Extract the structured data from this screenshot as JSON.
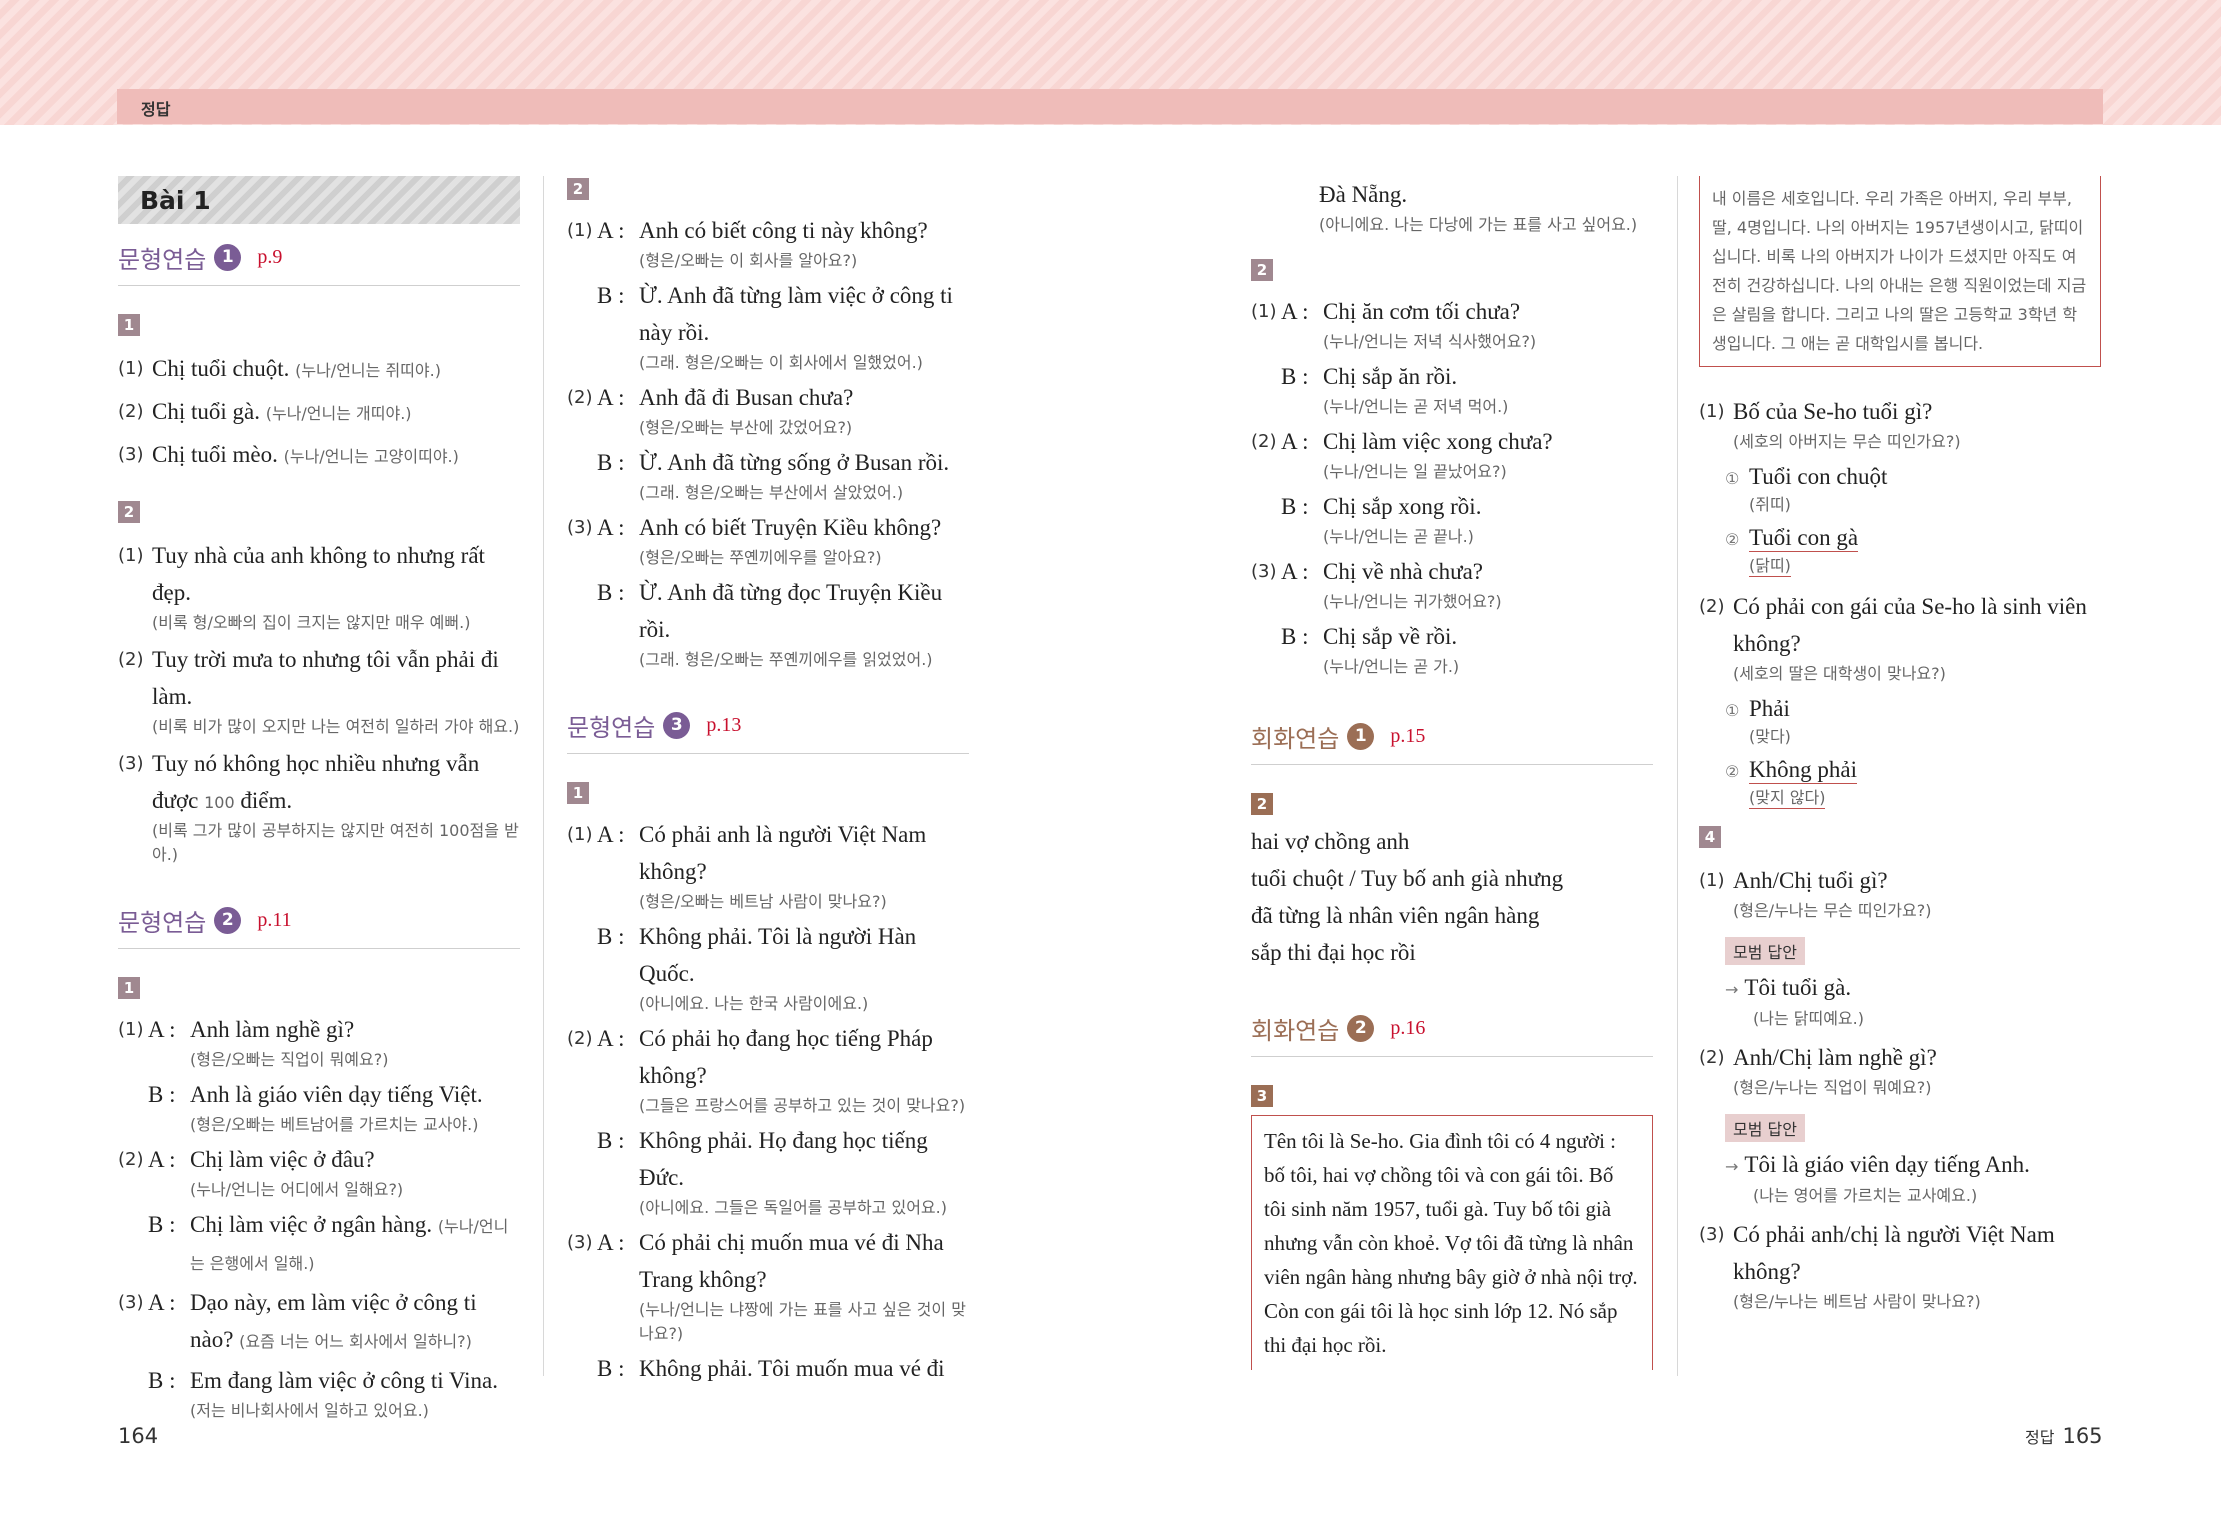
{
  "header": {
    "label": "정답"
  },
  "col1": {
    "bai": "Bài 1",
    "sec1": {
      "title": "문형연습",
      "num": "1",
      "page": "p.9"
    },
    "ex1": {
      "box": "1",
      "items": [
        {
          "num": "(1)",
          "vi": "Chị tuổi chuột.",
          "ko": "(누나/언니는 쥐띠야.)"
        },
        {
          "num": "(2)",
          "vi": "Chị tuổi gà.",
          "ko": "(누나/언니는 개띠야.)"
        },
        {
          "num": "(3)",
          "vi": "Chị tuổi mèo.",
          "ko": "(누나/언니는 고양이띠야.)"
        }
      ]
    },
    "ex2": {
      "box": "2",
      "items": [
        {
          "num": "(1)",
          "vi": "Tuy nhà của anh không to nhưng rất đẹp.",
          "ko": "(비록 형/오빠의 집이 크지는 않지만 매우 예뻐.)"
        },
        {
          "num": "(2)",
          "vi": "Tuy trời mưa to nhưng tôi vẫn phải đi làm.",
          "ko": "(비록 비가 많이 오지만 나는 여전히 일하러 가야 해요.)"
        },
        {
          "num": "(3)",
          "vi_a": "Tuy nó không học nhiều nhưng vẫn được ",
          "vi_num": "100",
          "vi_b": " điểm.",
          "ko": "(비록 그가 많이 공부하지는 않지만 여전히 100점을 받아.)"
        }
      ]
    },
    "sec2": {
      "title": "문형연습",
      "num": "2",
      "page": "p.11"
    },
    "ex3": {
      "box": "1",
      "items": [
        {
          "num": "(1)",
          "a_label": "A :",
          "a_vi": "Anh làm nghề gì?",
          "a_ko": "(형은/오빠는 직업이 뭐예요?)",
          "b_label": "B :",
          "b_vi": "Anh là giáo viên dạy tiếng Việt.",
          "b_ko": "(형은/오빠는 베트남어를 가르치는 교사야.)"
        },
        {
          "num": "(2)",
          "a_label": "A :",
          "a_vi": "Chị làm việc ở đâu?",
          "a_ko": "(누나/언니는 어디에서 일해요?)",
          "b_label": "B :",
          "b_vi": "Chị làm việc ở ngân hàng.",
          "b_ko": "(누나/언니는 은행에서 일해.)"
        },
        {
          "num": "(3)",
          "a_label": "A :",
          "a_vi": "Dạo này, em làm việc ở công ti nào?",
          "a_ko": "(요즘 너는 어느 회사에서 일하니?)",
          "b_label": "B :",
          "b_vi": "Em đang làm việc ở công ti Vina.",
          "b_ko": "(저는 비나회사에서 일하고 있어요.)"
        }
      ]
    }
  },
  "col2": {
    "ex1": {
      "box": "2",
      "items": [
        {
          "num": "(1)",
          "a_label": "A :",
          "a_vi": "Anh có biết công ti này không?",
          "a_ko": "(형은/오빠는 이 회사를 알아요?)",
          "b_label": "B :",
          "b_vi": "Ừ. Anh đã từng làm việc ở công ti này rồi.",
          "b_ko": "(그래. 형은/오빠는 이 회사에서 일했었어.)"
        },
        {
          "num": "(2)",
          "a_label": "A :",
          "a_vi": "Anh đã đi Busan chưa?",
          "a_ko": "(형은/오빠는 부산에 갔었어요?)",
          "b_label": "B :",
          "b_vi": "Ừ. Anh đã từng sống ở Busan rồi.",
          "b_ko": "(그래. 형은/오빠는 부산에서 살았었어.)"
        },
        {
          "num": "(3)",
          "a_label": "A :",
          "a_vi": "Anh có biết Truyện Kiều không?",
          "a_ko": "(형은/오빠는 쭈옌끼에우를 알아요?)",
          "b_label": "B :",
          "b_vi": "Ừ. Anh đã từng đọc Truyện Kiều rồi.",
          "b_ko": "(그래. 형은/오빠는 쭈옌끼에우를 읽었었어.)"
        }
      ]
    },
    "sec3": {
      "title": "문형연습",
      "num": "3",
      "page": "p.13"
    },
    "ex2": {
      "box": "1",
      "items": [
        {
          "num": "(1)",
          "a_label": "A :",
          "a_vi": "Có phải anh là người Việt Nam không?",
          "a_ko": "(형은/오빠는 베트남 사람이 맞나요?)",
          "b_label": "B :",
          "b_vi": "Không phải. Tôi là người Hàn Quốc.",
          "b_ko": "(아니에요. 나는 한국 사람이에요.)"
        },
        {
          "num": "(2)",
          "a_label": "A :",
          "a_vi": "Có phải họ đang học tiếng Pháp không?",
          "a_ko": "(그들은 프랑스어를 공부하고 있는 것이 맞나요?)",
          "b_label": "B :",
          "b_vi": "Không phải. Họ đang học tiếng Đức.",
          "b_ko": "(아니에요. 그들은 독일어를 공부하고 있어요.)"
        },
        {
          "num": "(3)",
          "a_label": "A :",
          "a_vi": "Có phải chị muốn mua vé đi Nha Trang không?",
          "a_ko": "(누나/언니는 냐짱에 가는 표를 사고 싶은 것이 맞나요?)",
          "b_label": "B :",
          "b_vi": "Không phải. Tôi muốn mua vé đi"
        }
      ]
    }
  },
  "col3": {
    "cont_vi": "Đà Nẵng.",
    "cont_ko": "(아니에요. 나는 다낭에 가는 표를 사고 싶어요.)",
    "ex1": {
      "box": "2",
      "items": [
        {
          "num": "(1)",
          "a_label": "A :",
          "a_vi": "Chị ăn cơm tối chưa?",
          "a_ko": "(누나/언니는 저녁 식사했어요?)",
          "b_label": "B :",
          "b_vi": "Chị sắp ăn rồi.",
          "b_ko": "(누나/언니는 곧 저녁 먹어.)"
        },
        {
          "num": "(2)",
          "a_label": "A :",
          "a_vi": "Chị làm việc xong chưa?",
          "a_ko": "(누나/언니는 일 끝났어요?)",
          "b_label": "B :",
          "b_vi": "Chị sắp xong rồi.",
          "b_ko": "(누나/언니는 곧 끝나.)"
        },
        {
          "num": "(3)",
          "a_label": "A :",
          "a_vi": "Chị về nhà chưa?",
          "a_ko": "(누나/언니는 귀가했어요?)",
          "b_label": "B :",
          "b_vi": "Chị sắp về rồi.",
          "b_ko": "(누나/언니는 곧 가.)"
        }
      ]
    },
    "sec4": {
      "title": "회화연습",
      "num": "1",
      "page": "p.15"
    },
    "ex2": {
      "box": "2",
      "lines": [
        "hai vợ chồng anh",
        "tuổi chuột / Tuy bố anh già nhưng",
        "đã từng là nhân viên ngân hàng",
        "sắp thi đại học rồi"
      ]
    },
    "sec5": {
      "title": "회화연습",
      "num": "2",
      "page": "p.16"
    },
    "ex3": {
      "box": "3",
      "text": "Tên tôi là Se-ho. Gia đình tôi có 4 người : bố tôi, hai vợ chồng tôi và con gái tôi. Bố tôi sinh năm 1957, tuổi gà. Tuy bố tôi già nhưng vẫn còn khoẻ. Vợ tôi đã từng là nhân viên ngân hàng nhưng bây giờ ở nhà nội trợ. Còn con gái tôi là học sinh lớp 12. Nó sắp thi đại học rồi."
    }
  },
  "col4": {
    "kor_box": "내 이름은 세호입니다. 우리 가족은 아버지, 우리 부부, 딸, 4명입니다. 나의 아버지는 1957년생이시고, 닭띠이십니다. 비록 나의 아버지가 나이가 드셨지만 아직도 여전히 건강하십니다. 나의 아내는 은행 직원이었는데 지금은 살림을 합니다. 그리고 나의 딸은 고등학교 3학년 학생입니다. 그 애는 곧 대학입시를 봅니다.",
    "q1": {
      "num": "(1)",
      "vi": "Bố của Se-ho tuổi gì?",
      "ko": "(세호의 아버지는 무슨 띠인가요?)",
      "opts": [
        {
          "c": "①",
          "vi": "Tuổi con chuột",
          "ko": "(쥐띠)",
          "u": false
        },
        {
          "c": "②",
          "vi": "Tuổi con gà",
          "ko": "(닭띠)",
          "u": true
        }
      ]
    },
    "q2": {
      "num": "(2)",
      "vi": "Có phải con gái của Se-ho là sinh viên không?",
      "ko": "(세호의 딸은 대학생이 맞나요?)",
      "opts": [
        {
          "c": "①",
          "vi": "Phải",
          "ko": "(맞다)",
          "u": false
        },
        {
          "c": "②",
          "vi": "Không phải",
          "ko": "(맞지 않다)",
          "u": true
        }
      ]
    },
    "box4": "4",
    "r1": {
      "num": "(1)",
      "vi": "Anh/Chị tuổi gì?",
      "ko": "(형은/누나는 무슨 띠인가요?)",
      "model": "모범 답안",
      "arrow": "→",
      "ans": "Tôi tuổi gà.",
      "ans_ko": "(나는 닭띠예요.)"
    },
    "r2": {
      "num": "(2)",
      "vi": "Anh/Chị làm nghề gì?",
      "ko": "(형은/누나는 직업이 뭐예요?)",
      "model": "모범 답안",
      "arrow": "→",
      "ans": "Tôi là giáo viên dạy tiếng Anh.",
      "ans_ko": "(나는 영어를 가르치는 교사예요.)"
    },
    "r3": {
      "num": "(3)",
      "vi": "Có phải anh/chị là người Việt Nam không?",
      "ko": "(형은/누나는 베트남 사람이 맞나요?)"
    }
  },
  "footer": {
    "left_page": "164",
    "right_label": "정답",
    "right_page": "165"
  }
}
